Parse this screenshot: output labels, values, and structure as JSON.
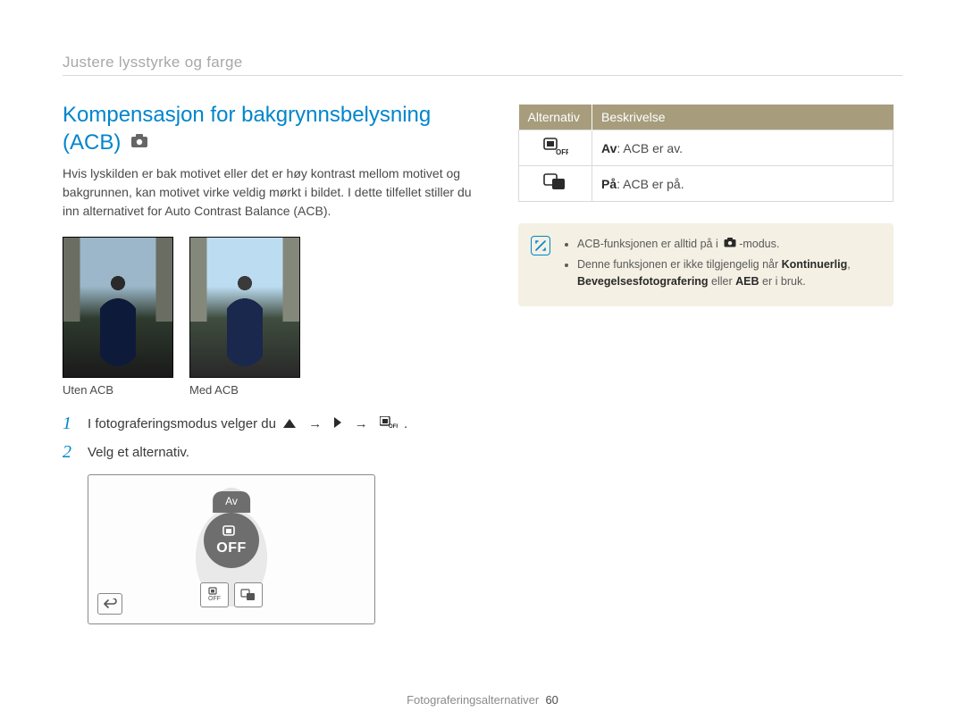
{
  "breadcrumb": "Justere lysstyrke og farge",
  "section_title": "Kompensasjon for bakgrynnsbelysning (ACB)",
  "intro_text": "Hvis lyskilden er bak motivet eller det er høy kontrast mellom motivet og bakgrunnen, kan motivet virke veldig mørkt i bildet. I dette tilfellet stiller du inn alternativet for Auto Contrast Balance (ACB).",
  "compare": {
    "without": "Uten ACB",
    "with": "Med ACB"
  },
  "steps": [
    {
      "num": "1",
      "text_prefix": "I fotograferingsmodus velger du ",
      "icons": true,
      "text_suffix": "."
    },
    {
      "num": "2",
      "text_prefix": "Velg et alternativ.",
      "icons": false,
      "text_suffix": ""
    }
  ],
  "screenshot": {
    "label_av": "Av",
    "off_text": "OFF",
    "thumb_off": "OFF"
  },
  "table": {
    "head_option": "Alternativ",
    "head_desc": "Beskrivelse",
    "rows": [
      {
        "icon": "acb-off-icon",
        "label_bold": "Av",
        "label_rest": ": ACB er av."
      },
      {
        "icon": "acb-on-icon",
        "label_bold": "På",
        "label_rest": ": ACB er på."
      }
    ]
  },
  "note": {
    "bullet1_a": "ACB-funksjonen er alltid på i ",
    "bullet1_b": "-modus.",
    "bullet2_a": "Denne funksjonen er ikke tilgjengelig når ",
    "bullet2_bold1": "Kontinuerlig",
    "bullet2_mid": ", ",
    "bullet2_bold2": "Bevegelsesfotografering",
    "bullet2_mid2": " eller ",
    "bullet2_bold3": "AEB",
    "bullet2_end": " er i bruk."
  },
  "footer": {
    "label": "Fotograferingsalternativer",
    "page": "60"
  }
}
